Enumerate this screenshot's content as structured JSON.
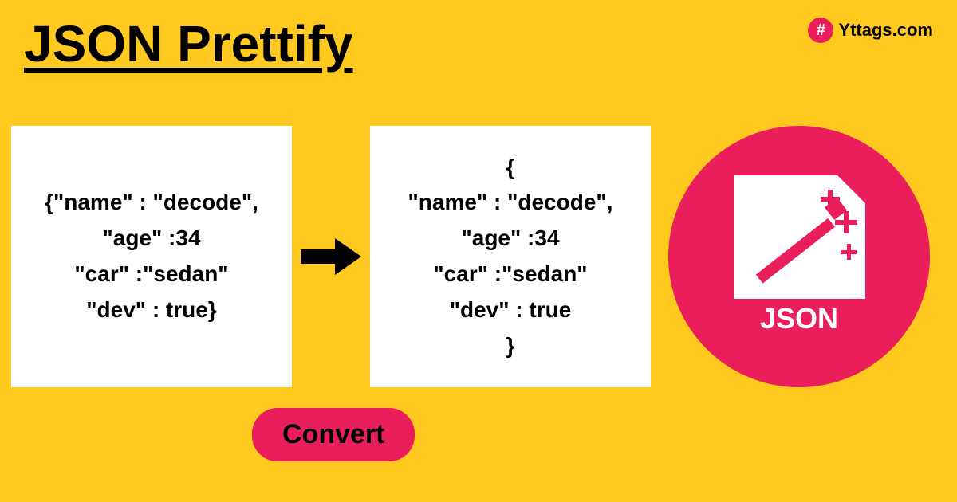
{
  "page": {
    "title": "JSON Prettify"
  },
  "brand": {
    "name": "Yttags.com",
    "icon_symbol": "#"
  },
  "input_box": {
    "content": "{\"name\" : \"decode\",\n\"age\" :34\n\"car\" :\"sedan\"\n\"dev\" : true}"
  },
  "output_box": {
    "content": "{\n\"name\" : \"decode\",\n\"age\" :34\n\"car\" :\"sedan\"\n\"dev\" : true\n}"
  },
  "convert_button": {
    "label": "Convert"
  },
  "json_badge": {
    "label": "JSON"
  },
  "colors": {
    "background": "#ffc91f",
    "accent": "#e91e5a",
    "text": "#000000",
    "box_bg": "#ffffff"
  }
}
